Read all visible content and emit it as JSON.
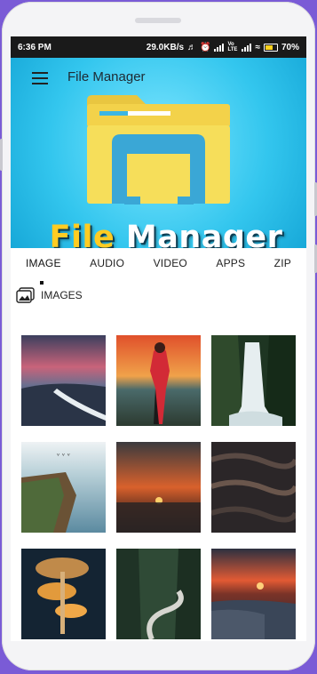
{
  "status": {
    "time": "6:36 PM",
    "speed": "29.0KB/s",
    "volte": "Vo LTE",
    "battery": "70%"
  },
  "header": {
    "title": "File Manager",
    "banner_word1": "File",
    "banner_word2": "Manager"
  },
  "tabs": [
    {
      "label": "IMAGE"
    },
    {
      "label": "AUDIO"
    },
    {
      "label": "VIDEO"
    },
    {
      "label": "APPS"
    },
    {
      "label": "ZIP"
    }
  ],
  "section": {
    "label": "IMAGES"
  },
  "images": [
    {
      "name": "coastal sunset waves"
    },
    {
      "name": "woman in red jacket at sunset"
    },
    {
      "name": "forest waterfall"
    },
    {
      "name": "cliffs with birds"
    },
    {
      "name": "orange sunset over sea"
    },
    {
      "name": "dark ocean waves"
    },
    {
      "name": "glowing mushrooms"
    },
    {
      "name": "forest road"
    },
    {
      "name": "red sunset rocky shore"
    }
  ]
}
